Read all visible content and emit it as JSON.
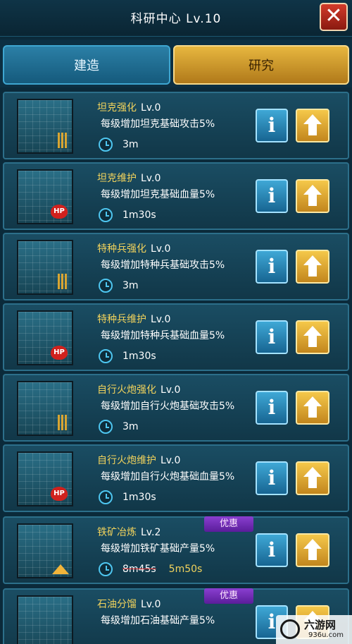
{
  "header": {
    "title": "科研中心 Lv.10",
    "close_label": "✕"
  },
  "tabs": [
    {
      "label": "建造",
      "active": false
    },
    {
      "label": "研究",
      "active": true
    }
  ],
  "items": [
    {
      "name": "坦克强化",
      "level": "Lv.0",
      "desc": "每级增加坦克基础攻击5%",
      "time": "3m",
      "icon": "tank-icon",
      "badge": "ammo"
    },
    {
      "name": "坦克维护",
      "level": "Lv.0",
      "desc": "每级增加坦克基础血量5%",
      "time": "1m30s",
      "icon": "tank-icon",
      "badge": "HP"
    },
    {
      "name": "特种兵强化",
      "level": "Lv.0",
      "desc": "每级增加特种兵基础攻击5%",
      "time": "3m",
      "icon": "soldier-icon",
      "badge": "ammo"
    },
    {
      "name": "特种兵维护",
      "level": "Lv.0",
      "desc": "每级增加特种兵基础血量5%",
      "time": "1m30s",
      "icon": "soldier-icon",
      "badge": "HP"
    },
    {
      "name": "自行火炮强化",
      "level": "Lv.0",
      "desc": "每级增加自行火炮基础攻击5%",
      "time": "3m",
      "icon": "artillery-icon",
      "badge": "ammo"
    },
    {
      "name": "自行火炮维护",
      "level": "Lv.0",
      "desc": "每级增加自行火炮基础血量5%",
      "time": "1m30s",
      "icon": "artillery-icon",
      "badge": "HP"
    },
    {
      "name": "铁矿冶炼",
      "level": "Lv.2",
      "desc": "每级增加铁矿基础产量5%",
      "time_old": "8m45s",
      "time": "5m50s",
      "icon": "iron-ore-icon",
      "badge": "up",
      "promo": "优惠"
    },
    {
      "name": "石油分馏",
      "level": "Lv.0",
      "desc": "每级增加石油基础产量5%",
      "icon": "oil-barrel-icon",
      "badge": "up",
      "promo": "优惠"
    }
  ],
  "buttons": {
    "info_label": "i"
  },
  "watermark": {
    "name": "六游网",
    "url": "936u.com"
  },
  "colors": {
    "accent_gold": "#f2d35c",
    "tab_active": "#e7b73f",
    "tab_inactive": "#2b7fa6",
    "promo": "#8a3fd0"
  }
}
